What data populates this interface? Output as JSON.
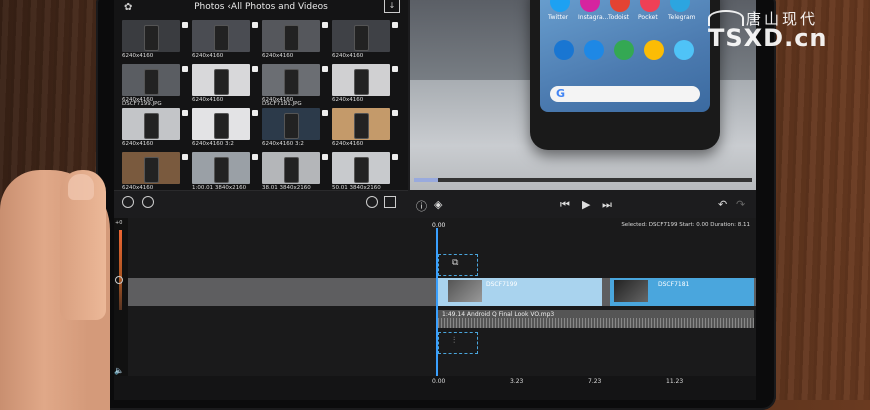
{
  "browser": {
    "title": "Photos ‹All Photos and Videos",
    "thumbs": [
      {
        "cap": "6240x4160",
        "bg": "#3a3c40"
      },
      {
        "cap": "6240x4160",
        "bg": "#4a4c52"
      },
      {
        "cap": "6240x4160",
        "bg": "#55575c"
      },
      {
        "cap": "6240x4160",
        "bg": "#3f4146"
      },
      {
        "cap": "6240x4160",
        "bg": "#5a5d62"
      },
      {
        "cap": "6240x4160",
        "bg": "#d8d8da"
      },
      {
        "cap": "6240x4160",
        "bg": "#6b6e73"
      },
      {
        "cap": "6240x4160",
        "bg": "#d0d0d2"
      },
      {
        "cap": "6240x4160",
        "bg": "#c3c5c8",
        "top": "DSCF7199.JPG"
      },
      {
        "cap": "6240x4160  3:2",
        "bg": "#e3e3e5"
      },
      {
        "cap": "6240x4160  3:2",
        "bg": "#2c3a4a",
        "top": "DSCF7181.JPG"
      },
      {
        "cap": "6240x4160",
        "bg": "#c49a6a"
      },
      {
        "cap": "6240x4160",
        "bg": "#7a5a3e"
      },
      {
        "cap": "1:00.01  3840x2160",
        "bg": "#9aa0a6"
      },
      {
        "cap": "38.01  3840x2160",
        "bg": "#b4b6b9"
      },
      {
        "cap": "50.01  3840x2160",
        "bg": "#c8cacd"
      }
    ]
  },
  "preview": {
    "apps": [
      {
        "label": "Twitter",
        "color": "#1da1f2"
      },
      {
        "label": "Instagra...",
        "color": "#d6249f"
      },
      {
        "label": "Todoist",
        "color": "#e44332"
      },
      {
        "label": "Pocket",
        "color": "#ef4056"
      },
      {
        "label": "Telegram",
        "color": "#2ca5e0"
      }
    ],
    "dock": [
      {
        "label": "",
        "color": "#1976d2"
      },
      {
        "label": "",
        "color": "#1e88e5"
      },
      {
        "label": "",
        "color": "#34a853"
      },
      {
        "label": "",
        "color": "#fbbc05"
      },
      {
        "label": "",
        "color": "#4fc3f7"
      }
    ]
  },
  "timeline": {
    "info": "Selected: DSCF7199  Start: 0.00  Duration: 8.11",
    "zero": "0.00",
    "clip1": "DSCF7199",
    "clip2": "DSCF7181",
    "audio": "1:49.14  Android Q Final Look VO.mp3",
    "ticks": [
      "0.00",
      "3.23",
      "7.23",
      "11.23"
    ],
    "meter_top": "+0"
  },
  "watermark": {
    "cn": "唐山现代",
    "en": "TSXD.cn"
  }
}
